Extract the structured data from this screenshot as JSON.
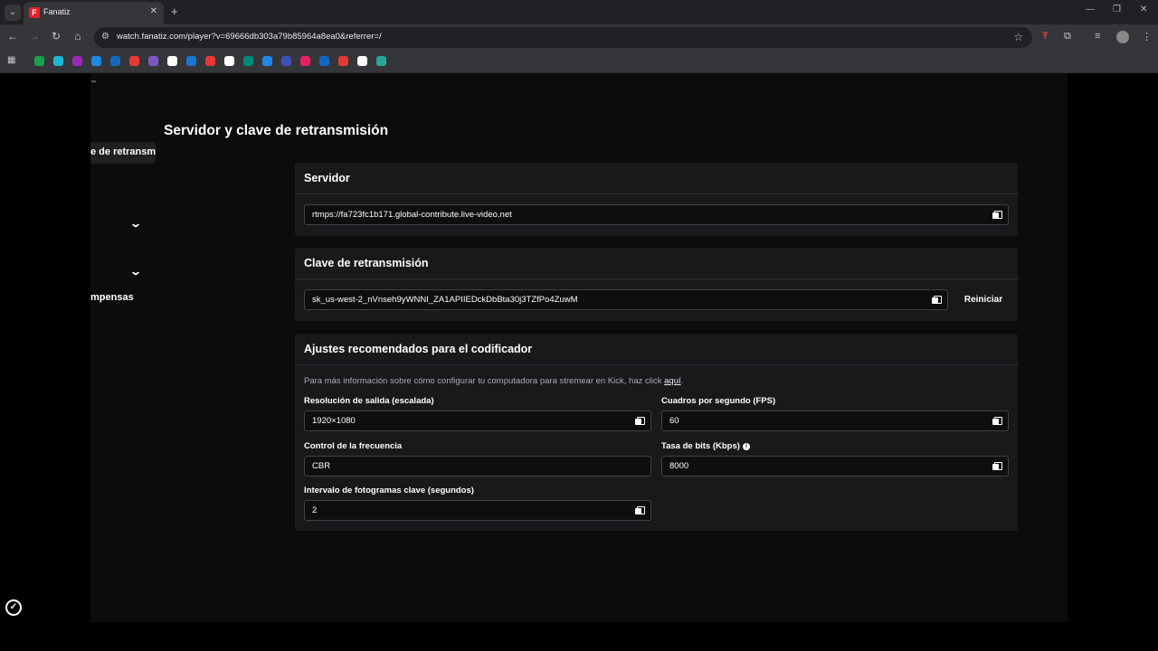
{
  "browser": {
    "tab_title": "Fanatiz",
    "tab_favicon_letter": "F",
    "url": "watch.fanatiz.com/player?v=69666db303a79b85964a8ea0&referrer=/",
    "bookmark_colors": [
      "#18a04a",
      "#1fb8d0",
      "#9c27b0",
      "#1e88e5",
      "#1565c0",
      "#e53935",
      "#7e57c2",
      "#ffffff",
      "#1976d2",
      "#e53935",
      "#ffffff",
      "#00897b",
      "#1e88e5",
      "#3f51b5",
      "#e91e63",
      "#1565c0",
      "#e53935",
      "#ffffff",
      "#26a69a"
    ]
  },
  "sidebar": {
    "tooltip": "e de retransm",
    "label": "mpensas"
  },
  "page_title": "Servidor y clave de retransmisión",
  "server": {
    "heading": "Servidor",
    "value": "rtmps://fa723fc1b171.global-contribute.live-video.net"
  },
  "stream_key": {
    "heading": "Clave de retransmisión",
    "value": "sk_us-west-2_nVnseh9yWNNI_ZA1APIIEDckDbBta30j3TZfPo4ZuwM",
    "reset_label": "Reiniciar"
  },
  "encoder": {
    "heading": "Ajustes recomendados para el codificador",
    "info_prefix": "Para más información sobre cómo configurar tu computadora para stremear en Kick, haz click ",
    "info_link": "aquí",
    "info_suffix": ".",
    "resolution_label": "Resolución de salida (escalada)",
    "resolution_value": "1920×1080",
    "fps_label": "Cuadros por segundo (FPS)",
    "fps_value": "60",
    "rate_control_label": "Control de la frecuencia",
    "rate_control_value": "CBR",
    "bitrate_label": "Tasa de bits (Kbps)",
    "bitrate_value": "8000",
    "keyframe_label": "Intervalo de fotogramas clave (segundos)",
    "keyframe_value": "2"
  }
}
